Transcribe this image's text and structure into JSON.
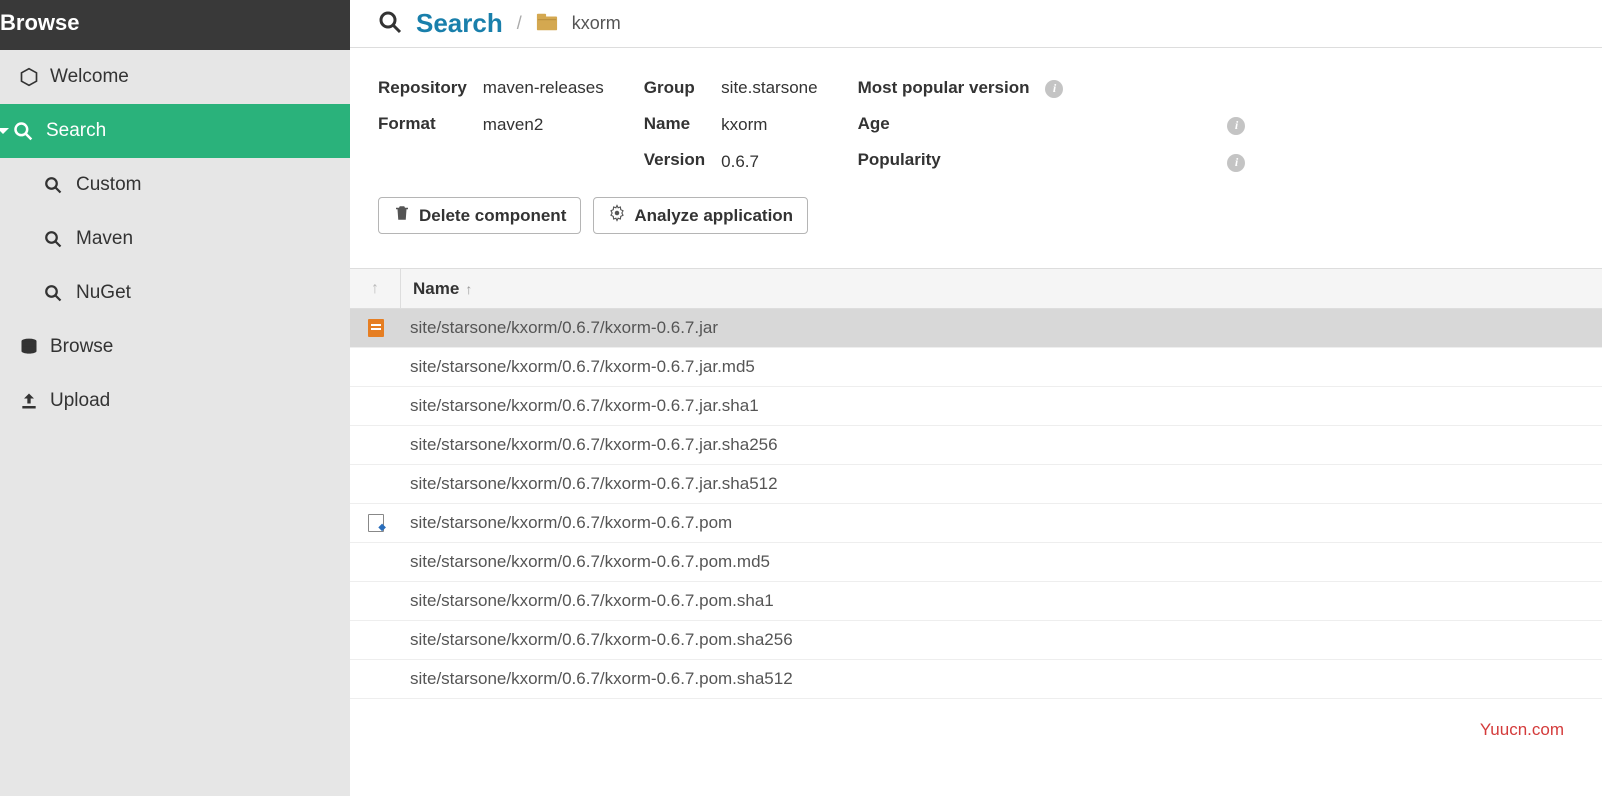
{
  "sidebar": {
    "header": "Browse",
    "items": [
      {
        "label": "Welcome",
        "icon": "hexagon"
      },
      {
        "label": "Search",
        "icon": "search",
        "active": true,
        "expanded": true
      },
      {
        "label": "Custom",
        "icon": "search",
        "sub": true
      },
      {
        "label": "Maven",
        "icon": "search",
        "sub": true
      },
      {
        "label": "NuGet",
        "icon": "search",
        "sub": true
      },
      {
        "label": "Browse",
        "icon": "database"
      },
      {
        "label": "Upload",
        "icon": "upload"
      }
    ]
  },
  "breadcrumb": {
    "root": "Search",
    "item": "kxorm"
  },
  "properties": {
    "col1": {
      "repository_label": "Repository",
      "repository_value": "maven-releases",
      "format_label": "Format",
      "format_value": "maven2"
    },
    "col2": {
      "group_label": "Group",
      "group_value": "site.starsone",
      "name_label": "Name",
      "name_value": "kxorm",
      "version_label": "Version",
      "version_value": "0.6.7"
    },
    "col3": {
      "mpv_label": "Most popular version",
      "age_label": "Age",
      "popularity_label": "Popularity"
    }
  },
  "actions": {
    "delete": "Delete component",
    "analyze": "Analyze application"
  },
  "table": {
    "name_header": "Name",
    "rows": [
      {
        "name": "site/starsone/kxorm/0.6.7/kxorm-0.6.7.jar",
        "icon": "java",
        "selected": true
      },
      {
        "name": "site/starsone/kxorm/0.6.7/kxorm-0.6.7.jar.md5"
      },
      {
        "name": "site/starsone/kxorm/0.6.7/kxorm-0.6.7.jar.sha1"
      },
      {
        "name": "site/starsone/kxorm/0.6.7/kxorm-0.6.7.jar.sha256"
      },
      {
        "name": "site/starsone/kxorm/0.6.7/kxorm-0.6.7.jar.sha512"
      },
      {
        "name": "site/starsone/kxorm/0.6.7/kxorm-0.6.7.pom",
        "icon": "pom"
      },
      {
        "name": "site/starsone/kxorm/0.6.7/kxorm-0.6.7.pom.md5"
      },
      {
        "name": "site/starsone/kxorm/0.6.7/kxorm-0.6.7.pom.sha1"
      },
      {
        "name": "site/starsone/kxorm/0.6.7/kxorm-0.6.7.pom.sha256"
      },
      {
        "name": "site/starsone/kxorm/0.6.7/kxorm-0.6.7.pom.sha512"
      }
    ]
  },
  "watermark": "Yuucn.com"
}
